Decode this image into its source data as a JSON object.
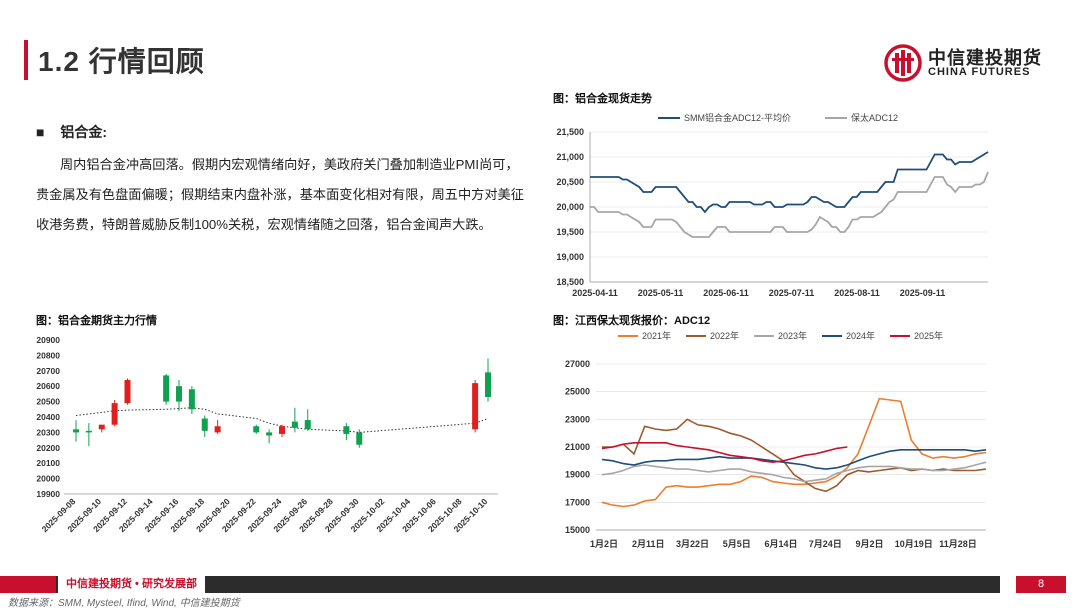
{
  "header": {
    "title": "1.2 行情回顾",
    "logo_cn": "中信建投期货",
    "logo_en": "CHINA FUTURES"
  },
  "section": {
    "bullet": "■",
    "heading": "铝合金:",
    "paragraph": "周内铝合金冲高回落。假期内宏观情绪向好，美政府关门叠加制造业PMI尚可，贵金属及有色盘面偏暖；假期结束内盘补涨，基本面变化相对有限，周五中方对美征收港务费，特朗普威胁反制100%关税，宏观情绪随之回落，铝合金闻声大跌。"
  },
  "footer": {
    "org": "中信建投期货 • 研究发展部",
    "page": "8",
    "source": "数据来源：SMM, Mysteel, Ifind, Wind, 中信建投期货"
  },
  "colors": {
    "accent": "#c8102e",
    "up": "#e0201e",
    "down": "#10a050",
    "navy": "#1f4e79",
    "gray": "#a6a6a6"
  },
  "chart_data": [
    {
      "id": "spot",
      "type": "line",
      "title": "图：铝合金现货走势",
      "ylim": [
        18500,
        21500
      ],
      "yticks": [
        "21,500",
        "21,000",
        "20,500",
        "20,000",
        "19,500",
        "19,000",
        "18,500"
      ],
      "x_labels": [
        "2025-04-11",
        "2025-05-11",
        "2025-06-11",
        "2025-07-11",
        "2025-08-11",
        "2025-09-11"
      ],
      "series": [
        {
          "name": "SMM铝合金ADC12-平均价",
          "color": "#1f4e79",
          "values": [
            20600,
            20600,
            20600,
            20600,
            20600,
            20600,
            20600,
            20600,
            20550,
            20550,
            20500,
            20450,
            20400,
            20300,
            20300,
            20300,
            20400,
            20400,
            20400,
            20400,
            20400,
            20400,
            20300,
            20200,
            20100,
            20100,
            20000,
            20000,
            19900,
            20000,
            20050,
            20050,
            20000,
            20000,
            20100,
            20100,
            20100,
            20100,
            20100,
            20100,
            20050,
            20050,
            20050,
            20100,
            20100,
            20000,
            20000,
            20000,
            20050,
            20050,
            20050,
            20050,
            20050,
            20100,
            20200,
            20200,
            20150,
            20100,
            20100,
            20050,
            20000,
            20000,
            20000,
            20100,
            20200,
            20200,
            20300,
            20300,
            20300,
            20300,
            20300,
            20400,
            20500,
            20500,
            20500,
            20750,
            20750,
            20750,
            20750,
            20750,
            20750,
            20750,
            20750,
            20900,
            21050,
            21050,
            21050,
            20950,
            20950,
            20850,
            20900,
            20900,
            20900,
            20900,
            20950,
            21000,
            21050,
            21100
          ]
        },
        {
          "name": "保太ADC12",
          "color": "#a6a6a6",
          "values": [
            20000,
            20000,
            19900,
            19900,
            19900,
            19900,
            19900,
            19900,
            19850,
            19850,
            19800,
            19750,
            19700,
            19600,
            19600,
            19600,
            19750,
            19750,
            19750,
            19750,
            19750,
            19700,
            19600,
            19500,
            19450,
            19400,
            19400,
            19400,
            19400,
            19400,
            19500,
            19600,
            19600,
            19600,
            19500,
            19500,
            19500,
            19500,
            19500,
            19500,
            19500,
            19500,
            19500,
            19500,
            19500,
            19600,
            19600,
            19600,
            19500,
            19500,
            19500,
            19500,
            19500,
            19500,
            19550,
            19650,
            19800,
            19750,
            19700,
            19600,
            19600,
            19500,
            19500,
            19600,
            19750,
            19750,
            19800,
            19800,
            19800,
            19800,
            19850,
            19900,
            20000,
            20100,
            20150,
            20300,
            20300,
            20300,
            20300,
            20300,
            20300,
            20300,
            20300,
            20450,
            20600,
            20600,
            20600,
            20450,
            20400,
            20300,
            20400,
            20400,
            20400,
            20400,
            20450,
            20450,
            20500,
            20700
          ]
        }
      ]
    },
    {
      "id": "kline",
      "type": "candlestick",
      "title": "图：铝合金期货主力行情",
      "ylim": [
        19900,
        20900
      ],
      "yticks": [
        "20900",
        "20800",
        "20700",
        "20600",
        "20500",
        "20400",
        "20300",
        "20200",
        "20100",
        "20000",
        "19900"
      ],
      "categories": [
        "2025-09-08",
        "2025-09-09",
        "2025-09-10",
        "2025-09-11",
        "2025-09-12",
        "2025-09-15",
        "2025-09-16",
        "2025-09-17",
        "2025-09-18",
        "2025-09-19",
        "2025-09-22",
        "2025-09-23",
        "2025-09-24",
        "2025-09-25",
        "2025-09-26",
        "2025-09-29",
        "2025-09-30",
        "2025-10-09",
        "2025-10-10"
      ],
      "x_labels": [
        "2025-09-08",
        "2025-09-10",
        "2025-09-12",
        "2025-09-14",
        "2025-09-16",
        "2025-09-18",
        "2025-09-20",
        "2025-09-22",
        "2025-09-24",
        "2025-09-26",
        "2025-09-28",
        "2025-09-30",
        "2025-10-02",
        "2025-10-04",
        "2025-10-06",
        "2025-10-08",
        "2025-10-10"
      ],
      "candles": [
        {
          "date": "2025-09-08",
          "open": 20320,
          "high": 20380,
          "low": 20240,
          "close": 20300
        },
        {
          "date": "2025-09-09",
          "open": 20310,
          "high": 20360,
          "low": 20210,
          "close": 20300
        },
        {
          "date": "2025-09-10",
          "open": 20320,
          "high": 20350,
          "low": 20300,
          "close": 20350
        },
        {
          "date": "2025-09-11",
          "open": 20350,
          "high": 20510,
          "low": 20340,
          "close": 20490
        },
        {
          "date": "2025-09-12",
          "open": 20490,
          "high": 20650,
          "low": 20480,
          "close": 20640
        },
        {
          "date": "2025-09-15",
          "open": 20670,
          "high": 20680,
          "low": 20480,
          "close": 20500
        },
        {
          "date": "2025-09-16",
          "open": 20600,
          "high": 20640,
          "low": 20440,
          "close": 20500
        },
        {
          "date": "2025-09-17",
          "open": 20580,
          "high": 20600,
          "low": 20420,
          "close": 20450
        },
        {
          "date": "2025-09-18",
          "open": 20390,
          "high": 20410,
          "low": 20270,
          "close": 20310
        },
        {
          "date": "2025-09-19",
          "open": 20300,
          "high": 20380,
          "low": 20290,
          "close": 20340
        },
        {
          "date": "2025-09-22",
          "open": 20340,
          "high": 20350,
          "low": 20290,
          "close": 20300
        },
        {
          "date": "2025-09-23",
          "open": 20300,
          "high": 20320,
          "low": 20230,
          "close": 20280
        },
        {
          "date": "2025-09-24",
          "open": 20290,
          "high": 20350,
          "low": 20270,
          "close": 20340
        },
        {
          "date": "2025-09-25",
          "open": 20370,
          "high": 20460,
          "low": 20300,
          "close": 20330
        },
        {
          "date": "2025-09-26",
          "open": 20380,
          "high": 20450,
          "low": 20310,
          "close": 20320
        },
        {
          "date": "2025-09-29",
          "open": 20340,
          "high": 20360,
          "low": 20250,
          "close": 20290
        },
        {
          "date": "2025-09-30",
          "open": 20300,
          "high": 20320,
          "low": 20200,
          "close": 20220
        },
        {
          "date": "2025-10-09",
          "open": 20320,
          "high": 20640,
          "low": 20300,
          "close": 20620
        },
        {
          "date": "2025-10-10",
          "open": 20690,
          "high": 20780,
          "low": 20500,
          "close": 20530
        }
      ],
      "ma": [
        20410,
        20420,
        20430,
        20440,
        20445,
        20450,
        20455,
        20460,
        20450,
        20420,
        20390,
        20360,
        20340,
        20330,
        20320,
        20310,
        20300,
        20360,
        20390
      ]
    },
    {
      "id": "season",
      "type": "line",
      "title": "图：江西保太现货报价：ADC12",
      "ylim": [
        15000,
        27000
      ],
      "yticks": [
        "27000",
        "25000",
        "23000",
        "21000",
        "19000",
        "17000",
        "15000"
      ],
      "x_labels": [
        "1月2日",
        "2月11日",
        "3月22日",
        "5月5日",
        "6月14日",
        "7月24日",
        "9月2日",
        "10月19日",
        "11月28日"
      ],
      "series": [
        {
          "name": "2021年",
          "color": "#ed7d31",
          "values": [
            17000,
            16800,
            16700,
            16800,
            17100,
            17200,
            18100,
            18200,
            18100,
            18100,
            18200,
            18300,
            18300,
            18500,
            18900,
            18800,
            18500,
            18400,
            18300,
            18300,
            18400,
            18500,
            18900,
            19500,
            20500,
            22500,
            24500,
            24400,
            24300,
            21500,
            20500,
            20200,
            20300,
            20200,
            20300,
            20500,
            20600
          ]
        },
        {
          "name": "2022年",
          "color": "#9c5a2e",
          "values": [
            21000,
            21000,
            21200,
            20500,
            22500,
            22300,
            22200,
            22300,
            23000,
            22600,
            22500,
            22300,
            22000,
            21800,
            21500,
            21000,
            20500,
            20000,
            19000,
            18500,
            18000,
            17800,
            18200,
            19000,
            19300,
            19200,
            19300,
            19400,
            19500,
            19300,
            19400,
            19300,
            19400,
            19300,
            19300,
            19300,
            19400
          ]
        },
        {
          "name": "2023年",
          "color": "#a6a6a6",
          "values": [
            19000,
            19100,
            19300,
            19600,
            19700,
            19600,
            19500,
            19400,
            19400,
            19300,
            19200,
            19300,
            19400,
            19400,
            19200,
            19100,
            19000,
            18800,
            18700,
            18500,
            18600,
            18700,
            19100,
            19300,
            19500,
            19600,
            19600,
            19600,
            19500,
            19400,
            19400,
            19300,
            19300,
            19400,
            19500,
            19700,
            19900
          ]
        },
        {
          "name": "2024年",
          "color": "#1f4e79",
          "values": [
            20100,
            20000,
            19800,
            19700,
            19900,
            20000,
            20000,
            20100,
            20100,
            20100,
            20200,
            20300,
            20200,
            20200,
            20200,
            20100,
            20000,
            19900,
            19800,
            19700,
            19500,
            19400,
            19500,
            19700,
            20000,
            20300,
            20500,
            20700,
            20800,
            20800,
            20800,
            20800,
            20800,
            20800,
            20800,
            20700,
            20800
          ]
        },
        {
          "name": "2025年",
          "color": "#c8102e",
          "values": [
            20900,
            21000,
            21200,
            21300,
            21300,
            21300,
            21300,
            21100,
            21000,
            20900,
            20800,
            20600,
            20400,
            20300,
            20200,
            20000,
            19900,
            20000,
            20200,
            20400,
            20500,
            20700,
            20900,
            21000
          ]
        }
      ]
    }
  ]
}
